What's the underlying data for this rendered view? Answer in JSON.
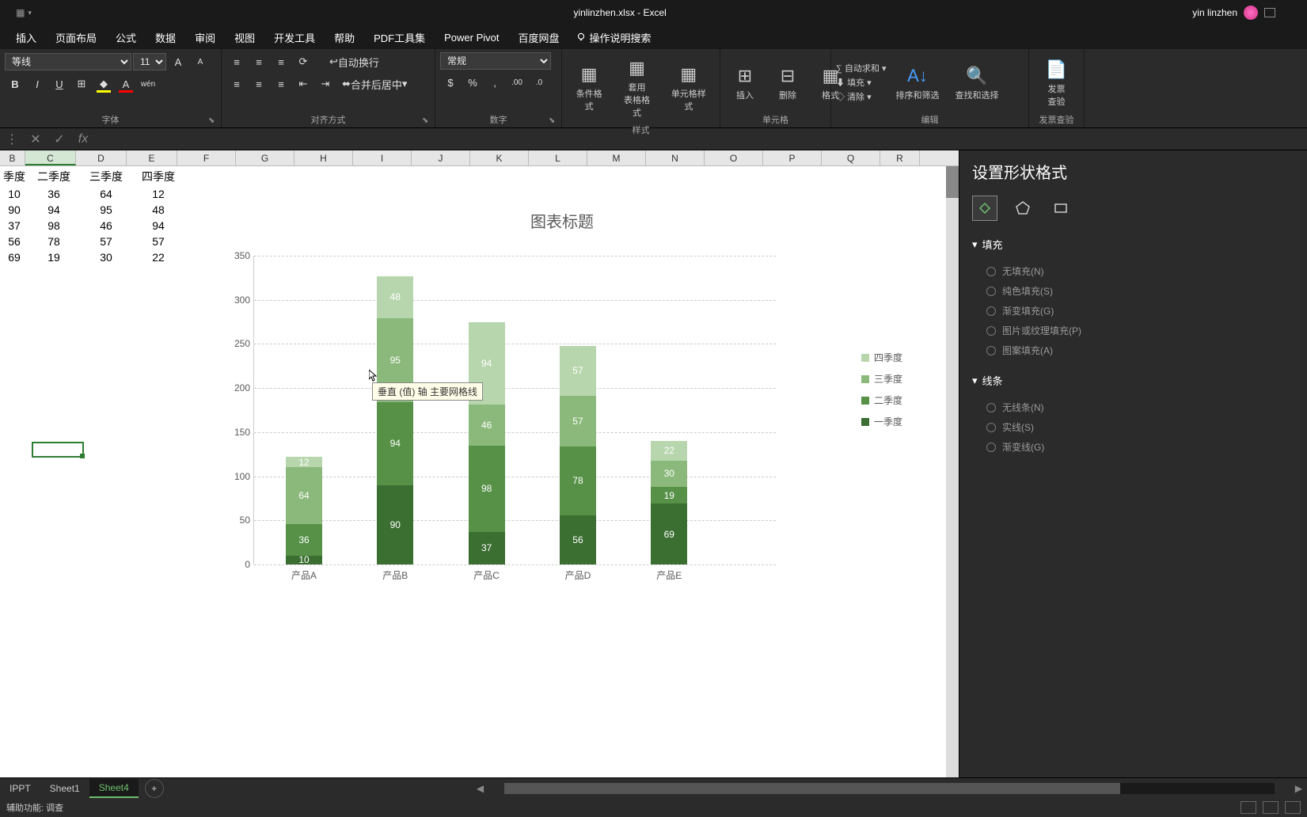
{
  "titlebar": {
    "filename": "yinlinzhen.xlsx - Excel",
    "username": "yin linzhen"
  },
  "menu": [
    "插入",
    "页面布局",
    "公式",
    "数据",
    "审阅",
    "视图",
    "开发工具",
    "帮助",
    "PDF工具集",
    "Power Pivot",
    "百度网盘"
  ],
  "search_placeholder": "操作说明搜索",
  "ribbon": {
    "font_name": "等线",
    "font_size": "11",
    "groups": {
      "font": "字体",
      "align": "对齐方式",
      "number": "数字",
      "styles": "样式",
      "cells": "单元格",
      "editing": "编辑",
      "invoice": "发票查验"
    },
    "wrap": "自动换行",
    "merge": "合并后居中",
    "number_format": "常规",
    "cond_format": "条件格式",
    "table_format": "套用\n表格格式",
    "cell_style": "单元格样式",
    "insert": "插入",
    "delete": "删除",
    "format": "格式",
    "autosum": "自动求和",
    "fill": "填充",
    "clear": "清除",
    "sort": "排序和筛选",
    "find": "查找和选择",
    "invoice_btn": "发票\n查验"
  },
  "columns": [
    "B",
    "C",
    "D",
    "E",
    "F",
    "G",
    "H",
    "I",
    "J",
    "K",
    "L",
    "M",
    "N",
    "O",
    "P",
    "Q",
    "R"
  ],
  "headers_row": [
    "季度",
    "二季度",
    "三季度",
    "四季度"
  ],
  "grid_data": [
    [
      10,
      36,
      64,
      12
    ],
    [
      90,
      94,
      95,
      48
    ],
    [
      37,
      98,
      46,
      94
    ],
    [
      56,
      78,
      57,
      57
    ],
    [
      69,
      19,
      30,
      22
    ]
  ],
  "chart_data": {
    "type": "bar",
    "stacked": true,
    "title": "图表标题",
    "categories": [
      "产品A",
      "产品B",
      "产品C",
      "产品D",
      "产品E"
    ],
    "series": [
      {
        "name": "一季度",
        "values": [
          10,
          90,
          37,
          56,
          69
        ],
        "color": "#3b6e31"
      },
      {
        "name": "二季度",
        "values": [
          36,
          94,
          98,
          78,
          19
        ],
        "color": "#569147"
      },
      {
        "name": "三季度",
        "values": [
          64,
          95,
          46,
          57,
          30
        ],
        "color": "#8ab97b"
      },
      {
        "name": "四季度",
        "values": [
          12,
          48,
          94,
          57,
          22
        ],
        "color": "#b8d6ad"
      }
    ],
    "ylim": [
      0,
      350
    ],
    "yticks": [
      0,
      50,
      100,
      150,
      200,
      250,
      300,
      350
    ],
    "legend_order": [
      "四季度",
      "三季度",
      "二季度",
      "一季度"
    ],
    "tooltip": "垂直 (值) 轴 主要网格线"
  },
  "panel": {
    "title": "设置形状格式",
    "fill": "填充",
    "line": "线条",
    "fill_options": [
      "无填充(N)",
      "纯色填充(S)",
      "渐变填充(G)",
      "图片或纹理填充(P)",
      "图案填充(A)"
    ],
    "line_options": [
      "无线条(N)",
      "实线(S)",
      "渐变线(G)"
    ]
  },
  "sheets": [
    "IPPT",
    "Sheet1",
    "Sheet4"
  ],
  "active_sheet": 2,
  "status": "辅助功能: 调查"
}
